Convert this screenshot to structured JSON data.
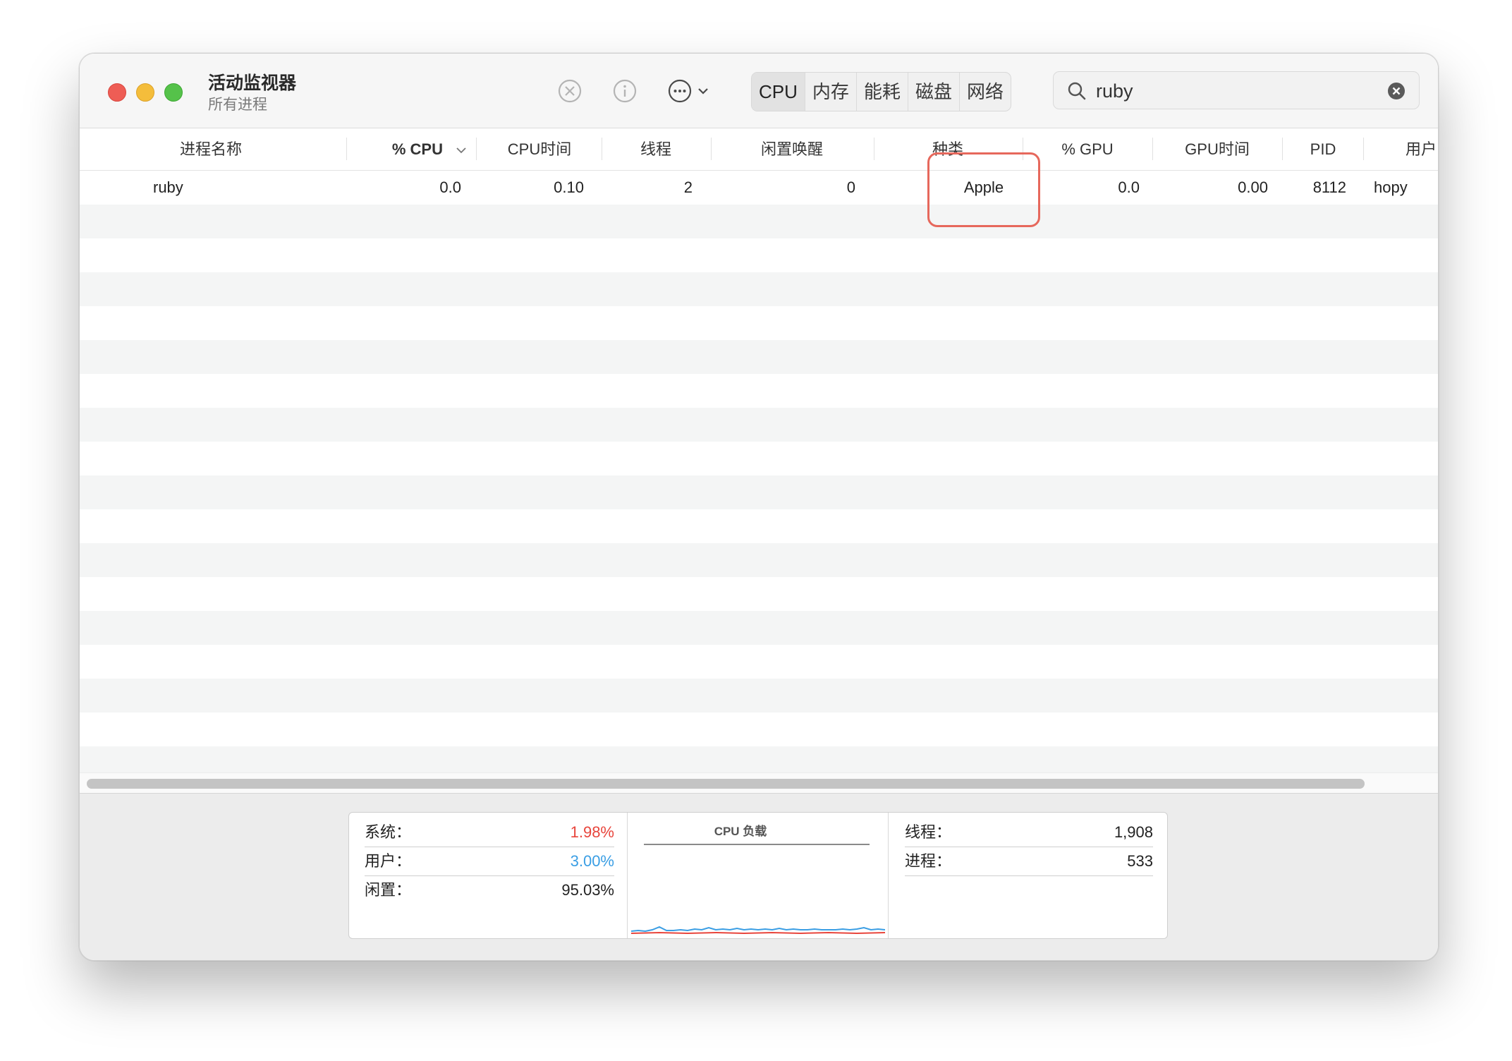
{
  "window": {
    "title": "活动监视器",
    "subtitle": "所有进程"
  },
  "toolbar": {
    "tabs": [
      {
        "label": "CPU",
        "active": true
      },
      {
        "label": "内存",
        "active": false
      },
      {
        "label": "能耗",
        "active": false
      },
      {
        "label": "磁盘",
        "active": false
      },
      {
        "label": "网络",
        "active": false
      }
    ],
    "search": {
      "value": "ruby"
    },
    "icons": [
      "stop-process-icon",
      "info-icon",
      "more-actions-icon",
      "chevron-down-icon",
      "search-icon",
      "clear-search-icon"
    ]
  },
  "table": {
    "columns": [
      "进程名称",
      "% CPU",
      "CPU时间",
      "线程",
      "闲置唤醒",
      "种类",
      "% GPU",
      "GPU时间",
      "PID",
      "用户"
    ],
    "sorted_column": "% CPU",
    "rows": [
      {
        "name": "ruby",
        "cpu": "0.0",
        "cpu_time": "0.10",
        "threads": "2",
        "idle_wake": "0",
        "kind": "Apple",
        "gpu": "0.0",
        "gpu_time": "0.00",
        "pid": "8112",
        "user": "hopy"
      }
    ]
  },
  "stats": {
    "system_label": "系统：",
    "system_value": "1.98%",
    "user_label": "用户：",
    "user_value": "3.00%",
    "idle_label": "闲置：",
    "idle_value": "95.03%",
    "chart_title": "CPU 负载",
    "threads_label": "线程：",
    "threads_value": "1,908",
    "processes_label": "进程：",
    "processes_value": "533"
  },
  "colors": {
    "system": "#e8453c",
    "user": "#3a9ee4",
    "highlight": "#e6685c"
  }
}
